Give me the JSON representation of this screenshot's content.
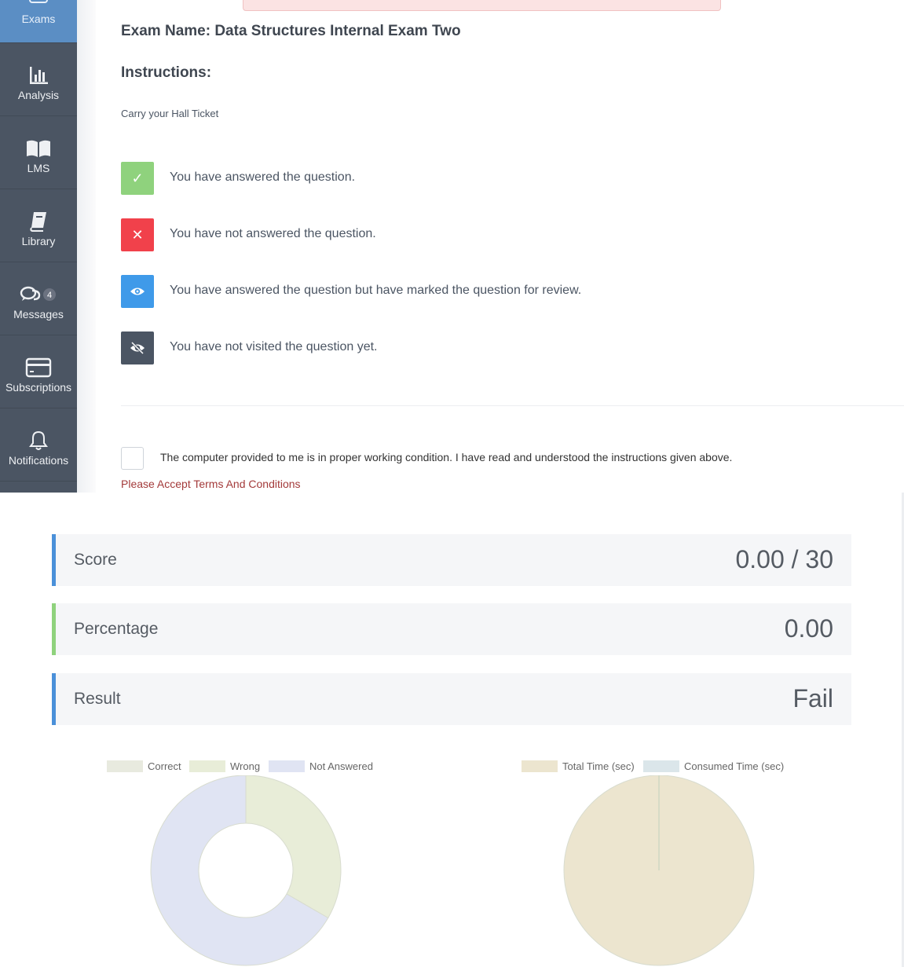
{
  "sidebar": {
    "items": [
      {
        "label": "Exams",
        "icon": "exams-icon"
      },
      {
        "label": "Analysis",
        "icon": "bar-chart-icon"
      },
      {
        "label": "LMS",
        "icon": "open-book-icon"
      },
      {
        "label": "Library",
        "icon": "book-icon"
      },
      {
        "label": "Messages",
        "icon": "chat-bubbles-icon",
        "badge": "4"
      },
      {
        "label": "Subscriptions",
        "icon": "credit-card-icon"
      },
      {
        "label": "Notifications",
        "icon": "bell-icon"
      }
    ]
  },
  "exam": {
    "name": "Exam Name: Data Structures Internal Exam Two",
    "instructions_heading": "Instructions:",
    "instruction_text": "Carry your Hall Ticket"
  },
  "legend": [
    {
      "icon": "check-icon",
      "glyph": "✓",
      "color": "#8fd27d",
      "text": "You have answered the question."
    },
    {
      "icon": "close-icon",
      "glyph": "✕",
      "color": "#f1414b",
      "text": "You have not answered the question."
    },
    {
      "icon": "eye-icon",
      "glyph": "",
      "color": "#3f9ae9",
      "text": "You have answered the question but have marked the question for review."
    },
    {
      "icon": "eye-slash-icon",
      "glyph": "",
      "color": "#4b5563",
      "text": "You have not visited the question yet."
    }
  ],
  "terms": {
    "checkbox_label": "The computer provided to me is in proper working condition. I have read and understood the instructions given above.",
    "error": "Please Accept Terms And Conditions"
  },
  "results": {
    "score_label": "Score",
    "score_value": "0.00 / 30",
    "score_accent": "#4a90d9",
    "percentage_label": "Percentage",
    "percentage_value": "0.00",
    "percentage_accent": "#8fd27d",
    "result_label": "Result",
    "result_value": "Fail",
    "result_accent": "#4a90d9"
  },
  "chart_data": [
    {
      "type": "pie",
      "variant": "doughnut",
      "legend_position": "top",
      "categories": [
        "Correct",
        "Wrong",
        "Not Answered"
      ],
      "values": [
        0,
        10,
        20
      ],
      "colors": [
        "#e8eadf",
        "#e8edd8",
        "#e0e4f3"
      ]
    },
    {
      "type": "pie",
      "legend_position": "top",
      "categories": [
        "Total Time (sec)",
        "Consumed Time (sec)"
      ],
      "values": [
        100,
        0
      ],
      "colors": [
        "#ece5cf",
        "#dbe6ea"
      ]
    }
  ]
}
